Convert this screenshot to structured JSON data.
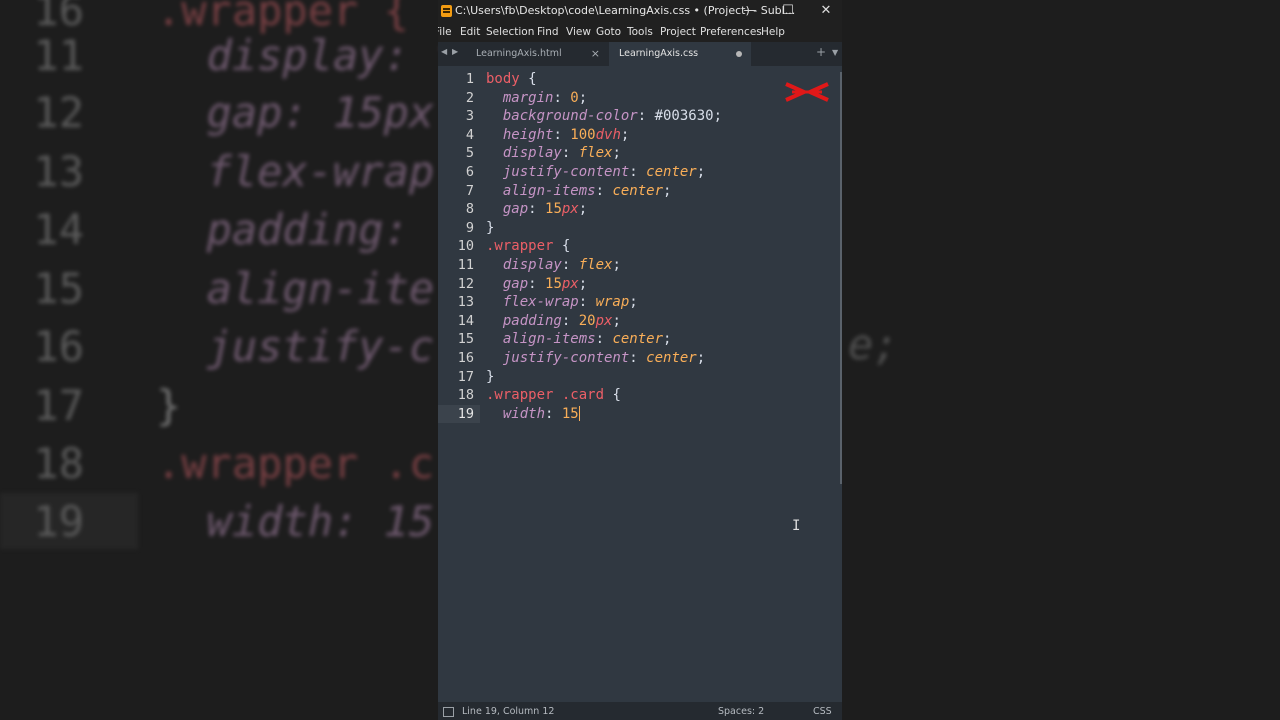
{
  "window": {
    "title": "C:\\Users\\fb\\Desktop\\code\\LearningAxis.css • (Project) - Subl...",
    "minimize": "—",
    "maximize": "☐",
    "close": "✕"
  },
  "menu": [
    "File",
    "Edit",
    "Selection",
    "Find",
    "View",
    "Goto",
    "Tools",
    "Project",
    "Preferences",
    "Help"
  ],
  "tabs": [
    {
      "label": "LearningAxis.html",
      "close": "×"
    },
    {
      "label": "LearningAxis.css"
    }
  ],
  "tab_add": "+",
  "tab_menu": "▼",
  "code_lines": [
    {
      "n": "1",
      "parts": [
        [
          "t-sel",
          "body"
        ],
        [
          "t-brace",
          " {"
        ]
      ]
    },
    {
      "n": "2",
      "parts": [
        [
          "t-punc",
          "  "
        ],
        [
          "t-prop",
          "margin"
        ],
        [
          "t-punc",
          ": "
        ],
        [
          "t-num",
          "0"
        ],
        [
          "t-punc",
          ";"
        ]
      ]
    },
    {
      "n": "3",
      "parts": [
        [
          "t-punc",
          "  "
        ],
        [
          "t-prop",
          "background-color"
        ],
        [
          "t-punc",
          ": "
        ],
        [
          "t-hex",
          "#003630"
        ],
        [
          "t-punc",
          ";"
        ]
      ]
    },
    {
      "n": "4",
      "parts": [
        [
          "t-punc",
          "  "
        ],
        [
          "t-prop",
          "height"
        ],
        [
          "t-punc",
          ": "
        ],
        [
          "t-num",
          "100"
        ],
        [
          "t-unit",
          "dvh"
        ],
        [
          "t-punc",
          ";"
        ]
      ]
    },
    {
      "n": "5",
      "parts": [
        [
          "t-punc",
          "  "
        ],
        [
          "t-prop",
          "display"
        ],
        [
          "t-punc",
          ": "
        ],
        [
          "t-kw",
          "flex"
        ],
        [
          "t-punc",
          ";"
        ]
      ]
    },
    {
      "n": "6",
      "parts": [
        [
          "t-punc",
          "  "
        ],
        [
          "t-prop",
          "justify-content"
        ],
        [
          "t-punc",
          ": "
        ],
        [
          "t-kw",
          "center"
        ],
        [
          "t-punc",
          ";"
        ]
      ]
    },
    {
      "n": "7",
      "parts": [
        [
          "t-punc",
          "  "
        ],
        [
          "t-prop",
          "align-items"
        ],
        [
          "t-punc",
          ": "
        ],
        [
          "t-kw",
          "center"
        ],
        [
          "t-punc",
          ";"
        ]
      ]
    },
    {
      "n": "8",
      "parts": [
        [
          "t-punc",
          "  "
        ],
        [
          "t-prop",
          "gap"
        ],
        [
          "t-punc",
          ": "
        ],
        [
          "t-num",
          "15"
        ],
        [
          "t-unit",
          "px"
        ],
        [
          "t-punc",
          ";"
        ]
      ]
    },
    {
      "n": "9",
      "parts": [
        [
          "t-brace",
          "}"
        ]
      ]
    },
    {
      "n": "10",
      "parts": [
        [
          "t-cls",
          ".wrapper"
        ],
        [
          "t-brace",
          " {"
        ]
      ]
    },
    {
      "n": "11",
      "parts": [
        [
          "t-punc",
          "  "
        ],
        [
          "t-prop",
          "display"
        ],
        [
          "t-punc",
          ": "
        ],
        [
          "t-kw",
          "flex"
        ],
        [
          "t-punc",
          ";"
        ]
      ]
    },
    {
      "n": "12",
      "parts": [
        [
          "t-punc",
          "  "
        ],
        [
          "t-prop",
          "gap"
        ],
        [
          "t-punc",
          ": "
        ],
        [
          "t-num",
          "15"
        ],
        [
          "t-unit",
          "px"
        ],
        [
          "t-punc",
          ";"
        ]
      ]
    },
    {
      "n": "13",
      "parts": [
        [
          "t-punc",
          "  "
        ],
        [
          "t-prop",
          "flex-wrap"
        ],
        [
          "t-punc",
          ": "
        ],
        [
          "t-kw",
          "wrap"
        ],
        [
          "t-punc",
          ";"
        ]
      ]
    },
    {
      "n": "14",
      "parts": [
        [
          "t-punc",
          "  "
        ],
        [
          "t-prop",
          "padding"
        ],
        [
          "t-punc",
          ": "
        ],
        [
          "t-num",
          "20"
        ],
        [
          "t-unit",
          "px"
        ],
        [
          "t-punc",
          ";"
        ]
      ]
    },
    {
      "n": "15",
      "parts": [
        [
          "t-punc",
          "  "
        ],
        [
          "t-prop",
          "align-items"
        ],
        [
          "t-punc",
          ": "
        ],
        [
          "t-kw",
          "center"
        ],
        [
          "t-punc",
          ";"
        ]
      ]
    },
    {
      "n": "16",
      "parts": [
        [
          "t-punc",
          "  "
        ],
        [
          "t-prop",
          "justify-content"
        ],
        [
          "t-punc",
          ": "
        ],
        [
          "t-kw",
          "center"
        ],
        [
          "t-punc",
          ";"
        ]
      ]
    },
    {
      "n": "17",
      "parts": [
        [
          "t-brace",
          "}"
        ]
      ]
    },
    {
      "n": "18",
      "parts": [
        [
          "t-cls",
          ".wrapper .card"
        ],
        [
          "t-brace",
          " {"
        ]
      ]
    },
    {
      "n": "19",
      "parts": [
        [
          "t-punc",
          "  "
        ],
        [
          "t-prop",
          "width"
        ],
        [
          "t-punc",
          ": "
        ],
        [
          "t-num",
          "15"
        ]
      ],
      "current": true
    }
  ],
  "status": {
    "position": "Line 19, Column 12",
    "indent": "Spaces: 2",
    "syntax": "CSS"
  },
  "background_zoom": {
    "rows": [
      {
        "n": "16",
        "code": ".wrapper {"
      },
      {
        "n": "11",
        "code": "  display: f"
      },
      {
        "n": "12",
        "code": "  gap: 15px"
      },
      {
        "n": "13",
        "code": "  flex-wrap"
      },
      {
        "n": "14",
        "code": "  padding: "
      },
      {
        "n": "15",
        "code": "  align-ite"
      },
      {
        "n": "16",
        "code": "  justify-c"
      },
      {
        "n": "17",
        "code": "}"
      },
      {
        "n": "18",
        "code": ".wrapper .c"
      },
      {
        "n": "19",
        "code": "  width: 15"
      }
    ],
    "right_fragment": "e;"
  },
  "colors": {
    "editor_bg": "#303841",
    "selector": "#ec5f67",
    "property": "#c594c5",
    "number": "#f9ae58",
    "logo": "#e01818"
  }
}
